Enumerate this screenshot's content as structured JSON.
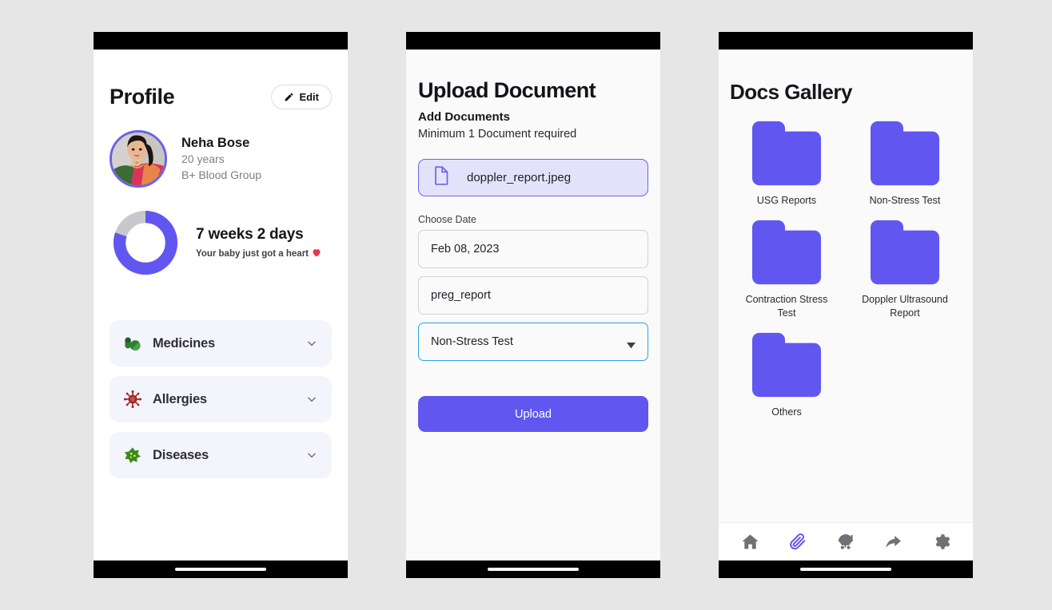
{
  "colors": {
    "accent_purple": "#6157f0",
    "accent_purple_dark": "#6a63e8",
    "chip_bg": "#e4e2fb",
    "select_border_blue": "#2aa3e8",
    "donut_track": "#c6c8cd",
    "page_bg": "#e6e6e6",
    "card_bg": "#f4f4fc",
    "medicine_green": "#2f7d32",
    "allergy_red": "#9e2a2a",
    "disease_green": "#3b8a1f",
    "heart_red": "#e8374a"
  },
  "profile_screen": {
    "title": "Profile",
    "edit_button": {
      "label": "Edit",
      "icon": "pencil-icon"
    },
    "user": {
      "name": "Neha Bose",
      "age": "20 years",
      "blood_group": "B+ Blood Group",
      "avatar_icon": "user-photo-avatar"
    },
    "pregnancy": {
      "duration": "7 weeks 2 days",
      "message": "Your baby just got a heart",
      "message_icon": "heart-icon",
      "progress_percent": 80
    },
    "accordion": [
      {
        "label": "Medicines",
        "icon": "pills-icon",
        "chevron": "chevron-down-icon"
      },
      {
        "label": "Allergies",
        "icon": "virus-icon",
        "chevron": "chevron-down-icon"
      },
      {
        "label": "Diseases",
        "icon": "germ-icon",
        "chevron": "chevron-down-icon"
      }
    ]
  },
  "upload_screen": {
    "title": "Upload Document",
    "section_heading": "Add Documents",
    "section_note": "Minimum 1 Document required",
    "document_chip": {
      "filename": "doppler_report.jpeg",
      "icon": "document-file-icon"
    },
    "date_label": "Choose Date",
    "date_value": "Feb 08, 2023",
    "name_value": "preg_report",
    "category_value": "Non-Stress Test",
    "category_caret_icon": "caret-down-icon",
    "submit_label": "Upload"
  },
  "gallery_screen": {
    "title": "Docs Gallery",
    "folders": [
      {
        "label": "USG Reports",
        "icon": "folder-icon"
      },
      {
        "label": "Non-Stress Test",
        "icon": "folder-icon"
      },
      {
        "label": "Contraction Stress Test",
        "icon": "folder-icon"
      },
      {
        "label": "Doppler Ultrasound Report",
        "icon": "folder-icon"
      },
      {
        "label": "Others",
        "icon": "folder-icon"
      }
    ],
    "tabbar": [
      {
        "icon": "home-icon",
        "active": false
      },
      {
        "icon": "paperclip-icon",
        "active": true
      },
      {
        "icon": "stroller-icon",
        "active": false
      },
      {
        "icon": "share-arrow-icon",
        "active": false
      },
      {
        "icon": "gear-icon",
        "active": false
      }
    ]
  }
}
